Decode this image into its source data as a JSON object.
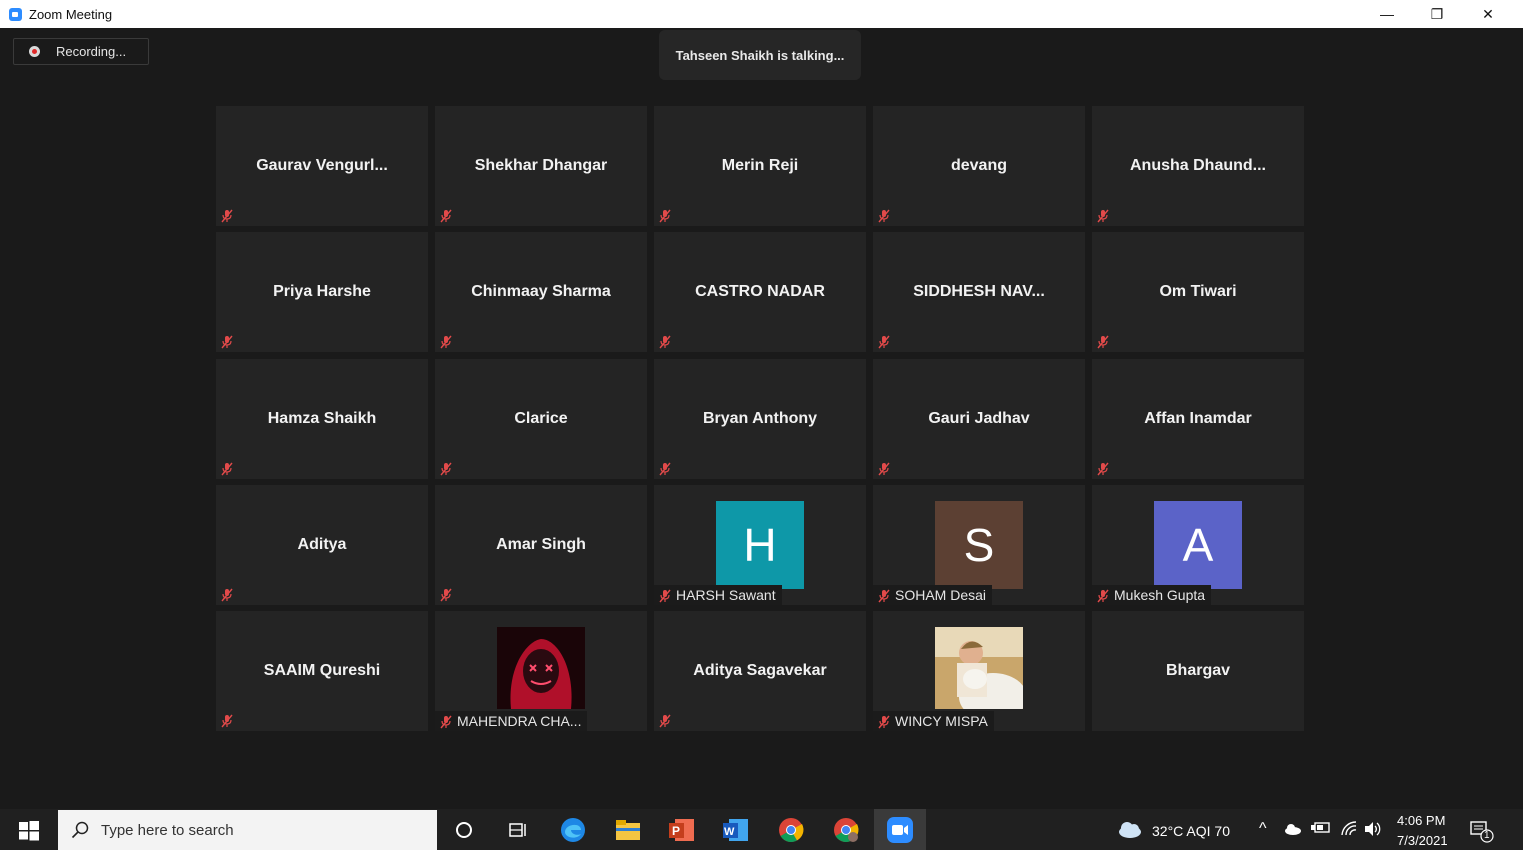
{
  "window": {
    "title": "Zoom Meeting",
    "minimize": "—",
    "restore": "❐",
    "close": "✕"
  },
  "recording": {
    "label": "Recording..."
  },
  "speaker": {
    "text": "Tahseen Shaikh is talking..."
  },
  "participants": [
    {
      "name": "Gaurav  Vengurl...",
      "display": "name"
    },
    {
      "name": "Shekhar Dhangar",
      "display": "name"
    },
    {
      "name": "Merin Reji",
      "display": "name"
    },
    {
      "name": "devang",
      "display": "name"
    },
    {
      "name": "Anusha  Dhaund...",
      "display": "name"
    },
    {
      "name": "Priya Harshe",
      "display": "name"
    },
    {
      "name": "Chinmaay Sharma",
      "display": "name"
    },
    {
      "name": "CASTRO NADAR",
      "display": "name"
    },
    {
      "name": "SIDDHESH  NAV...",
      "display": "name"
    },
    {
      "name": "Om Tiwari",
      "display": "name"
    },
    {
      "name": "Hamza Shaikh",
      "display": "name"
    },
    {
      "name": "Clarice",
      "display": "name"
    },
    {
      "name": "Bryan Anthony",
      "display": "name"
    },
    {
      "name": "Gauri Jadhav",
      "display": "name"
    },
    {
      "name": "Affan Inamdar",
      "display": "name"
    },
    {
      "name": "Aditya",
      "display": "name"
    },
    {
      "name": "Amar Singh",
      "display": "name"
    },
    {
      "name": "HARSH Sawant",
      "display": "avatar",
      "initial": "H",
      "color": "#0e98a8"
    },
    {
      "name": "SOHAM Desai",
      "display": "avatar",
      "initial": "S",
      "color": "#5c4033"
    },
    {
      "name": "Mukesh Gupta",
      "display": "avatar",
      "initial": "A",
      "color": "#5b63c8"
    },
    {
      "name": "SAAIM Qureshi",
      "display": "name"
    },
    {
      "name": "MAHENDRA CHA...",
      "display": "photo",
      "photo": "masked-face"
    },
    {
      "name": "Aditya Sagavekar",
      "display": "name"
    },
    {
      "name": "WINCY MISPA",
      "display": "photo",
      "photo": "person-eating"
    },
    {
      "name": "Bhargav",
      "display": "name",
      "unmuted": true
    }
  ],
  "taskbar": {
    "search_placeholder": "Type here to search",
    "weather": "32°C  AQI 70",
    "time": "4:06 PM",
    "date": "7/3/2021",
    "notification_count": "1"
  }
}
